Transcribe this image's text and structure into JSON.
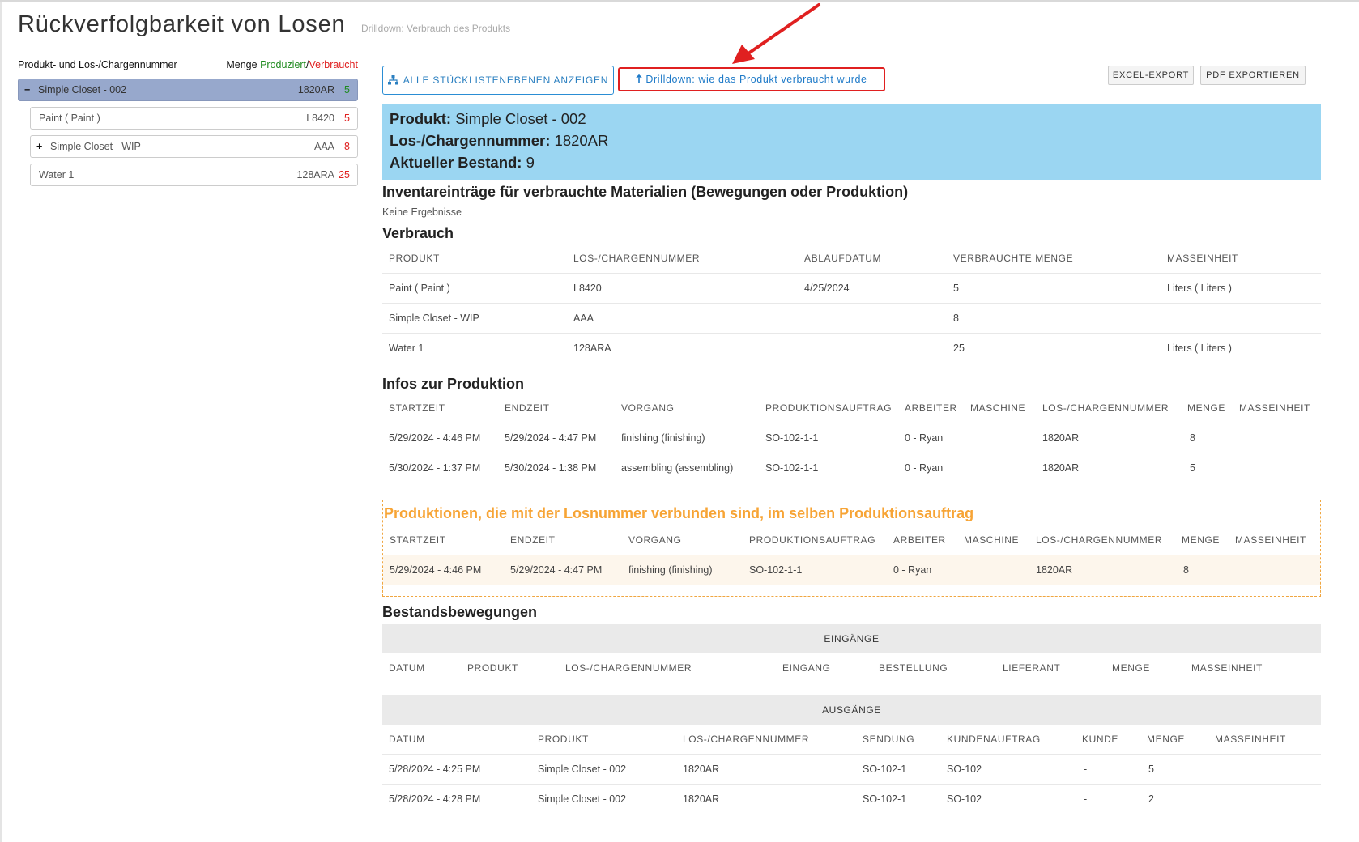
{
  "page": {
    "title": "Rückverfolgbarkeit von Losen",
    "subtitle": "Drilldown: Verbrauch des Produkts"
  },
  "left_panel": {
    "header_label": "Produkt- und Los-/Chargennummer",
    "header_qty": "Menge",
    "header_produced": "Produziert",
    "header_sep": "/",
    "header_consumed": "Verbraucht",
    "tree": [
      {
        "expander": "−",
        "name": "Simple Closet - 002",
        "lot": "1820AR",
        "qty": "5"
      },
      {
        "expander": "",
        "name": "Paint ( Paint )",
        "lot": "L8420",
        "qty": "5"
      },
      {
        "expander": "+",
        "name": "Simple Closet - WIP",
        "lot": "AAA",
        "qty": "8"
      },
      {
        "expander": "",
        "name": "Water 1",
        "lot": "128ARA",
        "qty": "25"
      }
    ]
  },
  "toolbar": {
    "show_all_label": "ALLE STÜCKLISTENEBENEN ANZEIGEN",
    "drilldown_label": "Drilldown: wie das Produkt verbraucht wurde",
    "excel_label": "EXCEL-EXPORT",
    "pdf_label": "PDF EXPORTIEREN"
  },
  "product_info": {
    "product_label": "Produkt:",
    "product_value": "Simple Closet - 002",
    "lot_label": "Los-/Chargennummer:",
    "lot_value": "1820AR",
    "stock_label": "Aktueller Bestand:",
    "stock_value": "9"
  },
  "inventory_section": {
    "title": "Inventareinträge für verbrauchte Materialien (Bewegungen oder Produktion)",
    "empty_text": "Keine Ergebnisse"
  },
  "consumption": {
    "title": "Verbrauch",
    "headers": [
      "PRODUKT",
      "LOS-/CHARGENNUMMER",
      "ABLAUFDATUM",
      "VERBRAUCHTE MENGE",
      "MASSEINHEIT"
    ],
    "rows": [
      [
        "Paint ( Paint )",
        "L8420",
        "4/25/2024",
        "5",
        "Liters ( Liters )"
      ],
      [
        "Simple Closet - WIP",
        "AAA",
        "",
        "8",
        ""
      ],
      [
        "Water 1",
        "128ARA",
        "",
        "25",
        "Liters ( Liters )"
      ]
    ]
  },
  "production": {
    "title": "Infos zur Produktion",
    "headers": [
      "STARTZEIT",
      "ENDZEIT",
      "VORGANG",
      "PRODUKTIONSAUFTRAG",
      "ARBEITER",
      "MASCHINE",
      "LOS-/CHARGENNUMMER",
      "MENGE",
      "MASSEINHEIT"
    ],
    "rows": [
      [
        "5/29/2024 - 4:46 PM",
        "5/29/2024 - 4:47 PM",
        "finishing (finishing)",
        "SO-102-1-1",
        "0 - Ryan",
        "",
        "1820AR",
        "8",
        ""
      ],
      [
        "5/30/2024 - 1:37 PM",
        "5/30/2024 - 1:38 PM",
        "assembling (assembling)",
        "SO-102-1-1",
        "0 - Ryan",
        "",
        "1820AR",
        "5",
        ""
      ]
    ]
  },
  "related_productions": {
    "title": "Produktionen, die mit der Losnummer verbunden sind, im selben Produktionsauftrag",
    "headers": [
      "STARTZEIT",
      "ENDZEIT",
      "VORGANG",
      "PRODUKTIONSAUFTRAG",
      "ARBEITER",
      "MASCHINE",
      "LOS-/CHARGENNUMMER",
      "MENGE",
      "MASSEINHEIT"
    ],
    "rows": [
      [
        "5/29/2024 - 4:46 PM",
        "5/29/2024 - 4:47 PM",
        "finishing (finishing)",
        "SO-102-1-1",
        "0 - Ryan",
        "",
        "1820AR",
        "8",
        ""
      ]
    ]
  },
  "stock_movements": {
    "title": "Bestandsbewegungen",
    "incoming": {
      "band_label": "EINGÄNGE",
      "headers": [
        "DATUM",
        "PRODUKT",
        "LOS-/CHARGENNUMMER",
        "EINGANG",
        "BESTELLUNG",
        "LIEFERANT",
        "MENGE",
        "MASSEINHEIT"
      ]
    },
    "outgoing": {
      "band_label": "AUSGÄNGE",
      "headers": [
        "DATUM",
        "PRODUKT",
        "LOS-/CHARGENNUMMER",
        "SENDUNG",
        "KUNDENAUFTRAG",
        "KUNDE",
        "MENGE",
        "MASSEINHEIT"
      ],
      "rows": [
        [
          "5/28/2024 - 4:25 PM",
          "Simple Closet - 002",
          "1820AR",
          "SO-102-1",
          "SO-102",
          "-",
          "5",
          ""
        ],
        [
          "5/28/2024 - 4:28 PM",
          "Simple Closet - 002",
          "1820AR",
          "SO-102-1",
          "SO-102",
          "-",
          "2",
          ""
        ]
      ]
    }
  }
}
